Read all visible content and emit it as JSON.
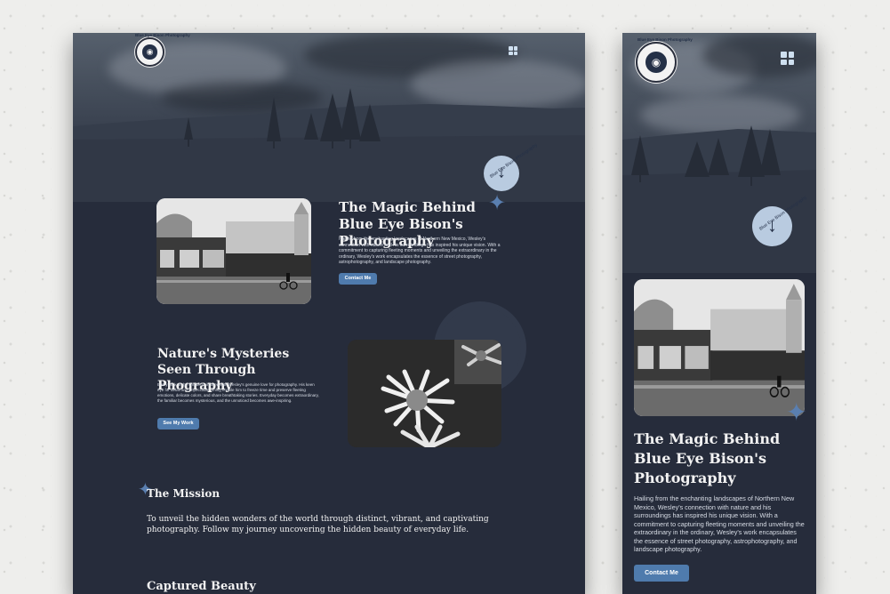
{
  "logo": {
    "text": "Blue Eye Bison Photography"
  },
  "scroll_badge": {
    "text": "Blue Eye Bison Photography"
  },
  "section1": {
    "title": "The Magic Behind Blue Eye Bison's Photography",
    "body": "Hailing from the enchanting landscapes of Northern New Mexico, Wesley's connection with nature and his surroundings has inspired his unique vision. With a commitment to capturing fleeting moments and unveiling the extraordinary in the ordinary, Wesley's work encapsulates the essence of street photography, astrophotography, and landscape photography.",
    "cta": "Contact Me",
    "image_alt": "Black and white photo of a street building with a cyclist"
  },
  "section2": {
    "title": "Nature's Mysteries Seen Through Phography",
    "body": "Every click of the shutter is infused with Wesley's genuine love for photography. His keen eye for detail and impeccable timing enable him to freeze time and preserve fleeting emotions, delicate colors, and share breathtaking stories. Everyday becomes extraordinary, the familiar becomes mysterious, and the unnoticed becomes awe-inspiring.",
    "cta": "See My Work",
    "image_alt": "Black and white close up photo of daisies"
  },
  "mission": {
    "title": "The Mission",
    "body": "To unveil the hidden wonders of the world through distinct, vibrant, and captivating photography. Follow my journey uncovering the hidden beauty of everyday life."
  },
  "gallery": {
    "title": "Captured Beauty"
  },
  "icons": {
    "menu": "grid-menu-icon",
    "scroll": "arrow-down-icon",
    "sparkle": "four-point-star-icon",
    "gear": "gear-shape"
  },
  "colors": {
    "background": "#262c3b",
    "accent": "#4f7bad",
    "badge": "#b9cbe0",
    "text": "#f2f2f2"
  }
}
